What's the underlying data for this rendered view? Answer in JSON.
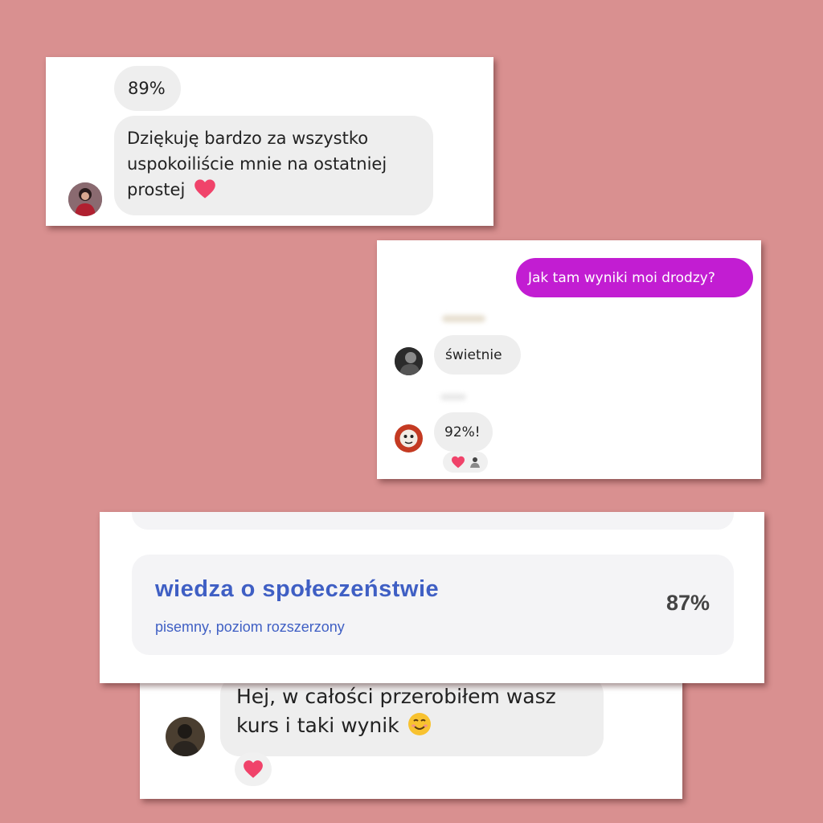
{
  "chat1": {
    "msg_percent": "89%",
    "msg_thanks": {
      "line1": "Dziękuję bardzo za wszystko",
      "line2": "uspokoiliście mnie na ostatniej",
      "line3": "prostej"
    },
    "emoji": "heart-icon"
  },
  "chat2": {
    "outgoing": "Jak tam wyniki moi drodzy?",
    "reply1": "świetnie",
    "reply2": "92%!",
    "reactions": [
      "heart-icon",
      "person-icon"
    ],
    "outgoing_color": "#c21dd2"
  },
  "result": {
    "subject": "wiedza o społeczeństwie",
    "level": "pisemny, poziom rozszerzony",
    "score": "87%",
    "accent_color": "#3f5fc4"
  },
  "chat3": {
    "line1": "Hej, w całości przerobiłem wasz",
    "line2": "kurs i taki wynik",
    "emoji": "smiling-face-icon",
    "reaction": "heart-icon"
  },
  "colors": {
    "background": "#d99090",
    "bubble": "#eeeeee"
  }
}
